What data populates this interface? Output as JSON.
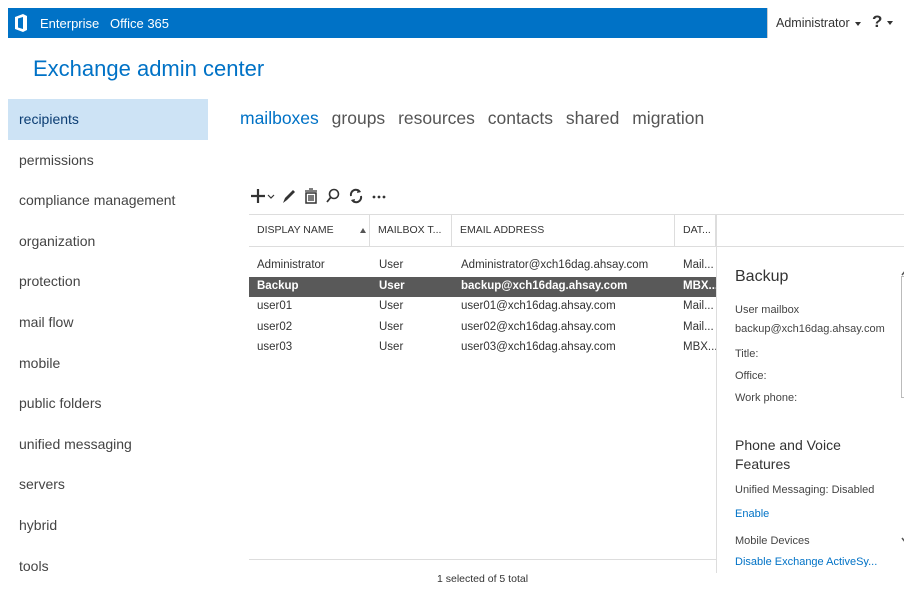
{
  "topbar": {
    "nav1": "Enterprise",
    "nav2": "Office 365",
    "user": "Administrator",
    "help": "?"
  },
  "app_title": "Exchange admin center",
  "sidebar": {
    "items": [
      {
        "label": "recipients",
        "active": true
      },
      {
        "label": "permissions"
      },
      {
        "label": "compliance management"
      },
      {
        "label": "organization"
      },
      {
        "label": "protection"
      },
      {
        "label": "mail flow"
      },
      {
        "label": "mobile"
      },
      {
        "label": "public folders"
      },
      {
        "label": "unified messaging"
      },
      {
        "label": "servers"
      },
      {
        "label": "hybrid"
      },
      {
        "label": "tools"
      }
    ]
  },
  "tabs": [
    "mailboxes",
    "groups",
    "resources",
    "contacts",
    "shared",
    "migration"
  ],
  "toolbar": {
    "icons": [
      "add-icon",
      "edit-icon",
      "delete-icon",
      "search-icon",
      "refresh-icon",
      "more-icon"
    ]
  },
  "table": {
    "columns": [
      "DISPLAY NAME",
      "MAILBOX T...",
      "EMAIL ADDRESS",
      "DAT..."
    ],
    "rows": [
      {
        "name": "Administrator",
        "type": "User",
        "email": "Administrator@xch16dag.ahsay.com",
        "db": "Mail..."
      },
      {
        "name": "Backup",
        "type": "User",
        "email": "backup@xch16dag.ahsay.com",
        "db": "MBX...",
        "selected": true
      },
      {
        "name": "user01",
        "type": "User",
        "email": "user01@xch16dag.ahsay.com",
        "db": "Mail..."
      },
      {
        "name": "user02",
        "type": "User",
        "email": "user02@xch16dag.ahsay.com",
        "db": "Mail..."
      },
      {
        "name": "user03",
        "type": "User",
        "email": "user03@xch16dag.ahsay.com",
        "db": "MBX..."
      }
    ]
  },
  "status": "1 selected of 5 total",
  "details": {
    "title": "Backup",
    "mailbox_type": "User mailbox",
    "email": "backup@xch16dag.ahsay.com",
    "title_label": "Title:",
    "office_label": "Office:",
    "work_phone_label": "Work phone:",
    "phone_section": "Phone and Voice Features",
    "um_status": "Unified Messaging:  Disabled",
    "enable_link": "Enable",
    "mobile_section": "Mobile Devices",
    "disable_eas_link": "Disable Exchange ActiveSy..."
  },
  "colors": {
    "brand": "#0072c6",
    "sidebar_active": "#cde3f5",
    "row_selected": "#595959"
  }
}
